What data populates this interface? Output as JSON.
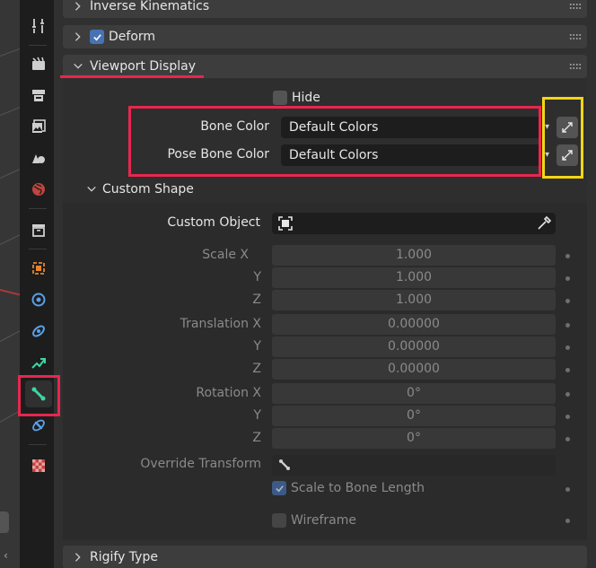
{
  "panels": {
    "inverse_kinematics": "Inverse Kinematics",
    "deform": "Deform",
    "viewport_display": "Viewport Display",
    "rigify_type": "Rigify Type"
  },
  "viewport_display": {
    "hide_label": "Hide",
    "bone_color_label": "Bone Color",
    "bone_color_value": "Default Colors",
    "pose_bone_color_label": "Pose Bone Color",
    "pose_bone_color_value": "Default Colors"
  },
  "custom_shape": {
    "title": "Custom Shape",
    "custom_object_label": "Custom Object",
    "scale_label": "Scale X",
    "translation_label": "Translation X",
    "rotation_label": "Rotation X",
    "axis_y": "Y",
    "axis_z": "Z",
    "scale": [
      "1.000",
      "1.000",
      "1.000"
    ],
    "translation": [
      "0.00000",
      "0.00000",
      "0.00000"
    ],
    "rotation": [
      "0°",
      "0°",
      "0°"
    ],
    "override_transform_label": "Override Transform",
    "scale_to_bone_length_label": "Scale to Bone Length",
    "wireframe_label": "Wireframe"
  },
  "colors": {
    "accent_blue": "#4772b3",
    "highlight_red": "#e8264f",
    "highlight_yellow": "#f5d514",
    "active_tab_icon": "#3cd6a5"
  },
  "icons": {
    "tabs": [
      "tool-icon",
      "render-icon",
      "output-icon",
      "view-layer-icon",
      "scene-icon",
      "world-icon",
      "collection-icon",
      "object-icon",
      "modifier-icon",
      "particles-icon",
      "physics-icon",
      "object-constraint-icon",
      "bone-icon",
      "bone-constraint-icon",
      "texture-icon"
    ]
  }
}
